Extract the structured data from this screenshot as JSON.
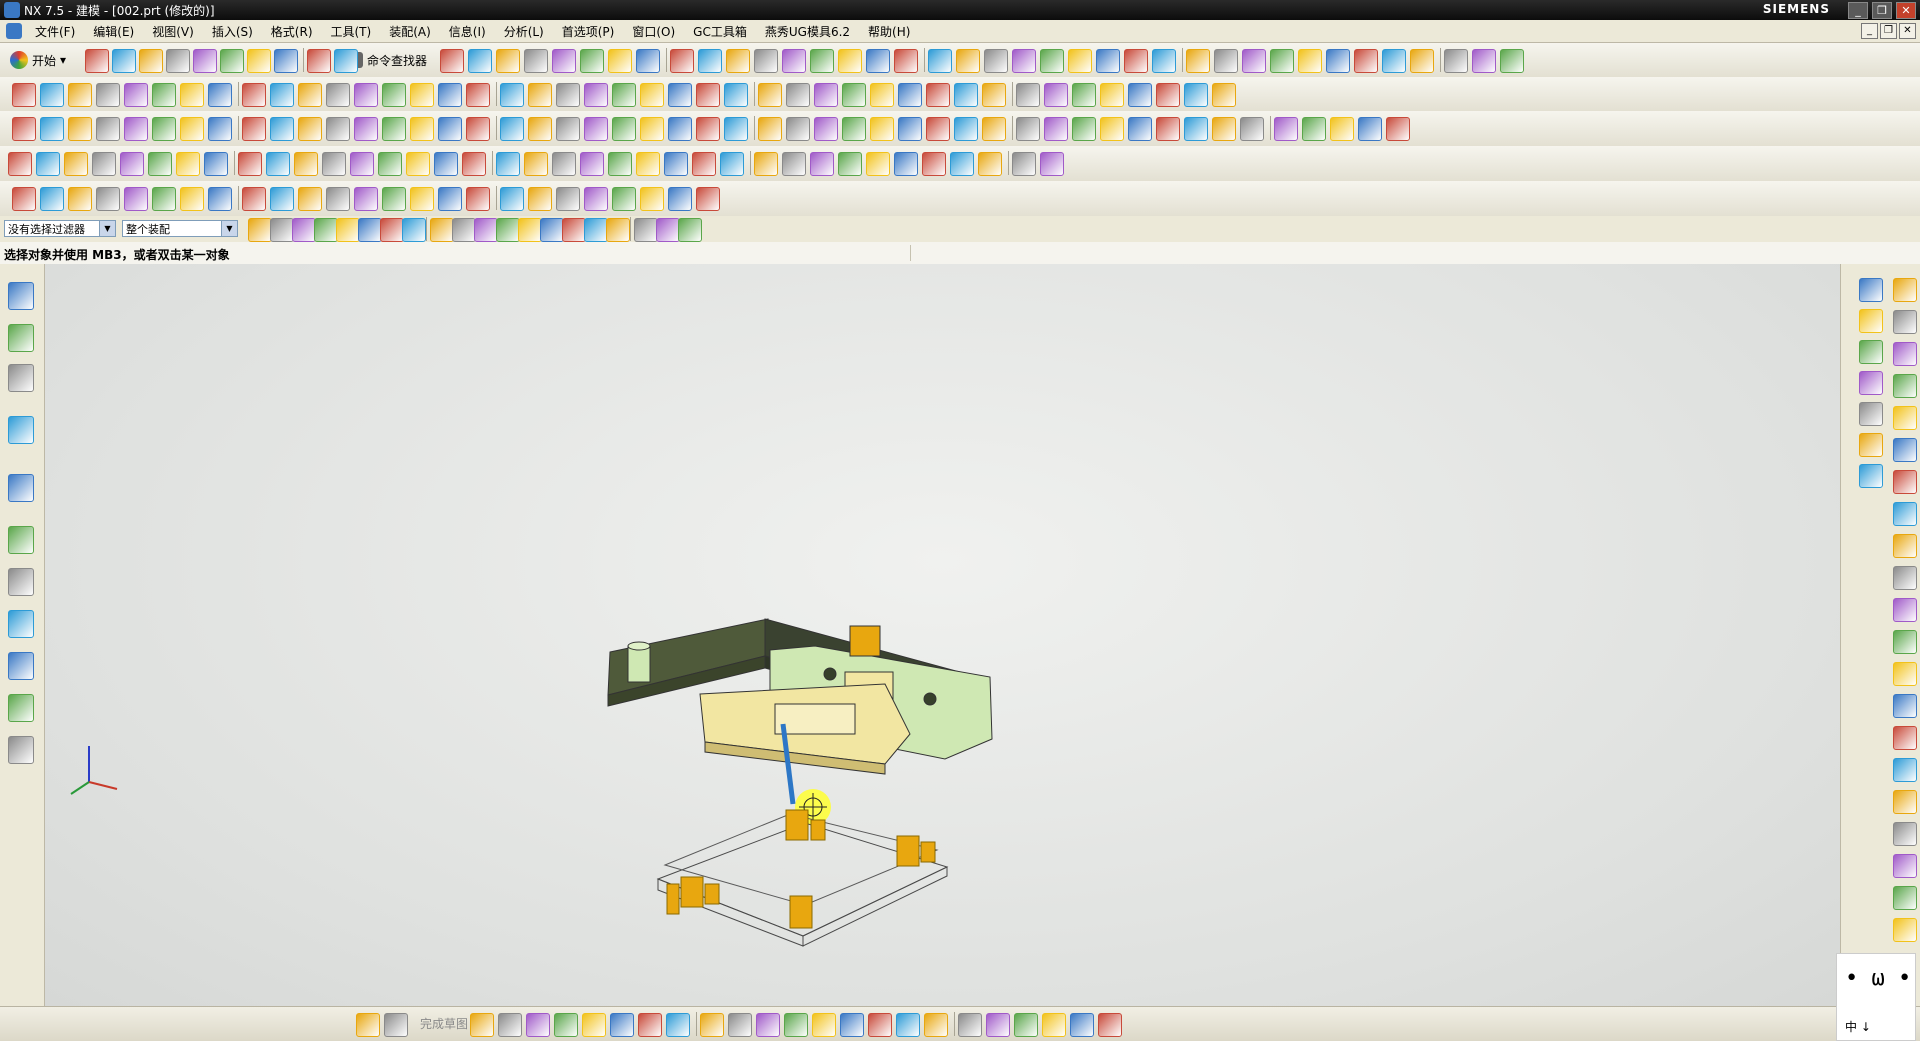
{
  "window": {
    "title": "NX 7.5 - 建模 - [002.prt (修改的)]",
    "brand": "SIEMENS"
  },
  "menu": [
    "文件(F)",
    "编辑(E)",
    "视图(V)",
    "插入(S)",
    "格式(R)",
    "工具(T)",
    "装配(A)",
    "信息(I)",
    "分析(L)",
    "首选项(P)",
    "窗口(O)",
    "GC工具箱",
    "燕秀UG模具6.2",
    "帮助(H)"
  ],
  "toolbar": {
    "start_label": "开始",
    "command_finder_label": "命令查找器"
  },
  "selection": {
    "filter_value": "没有选择过滤器",
    "scope_value": "整个装配"
  },
  "cue_line": "选择对象并使用 MB3，或者双击某一对象",
  "statusbar": {
    "finish_sketch": "完成草图"
  },
  "ime": {
    "face": "• ω •",
    "label": "中 ↓"
  },
  "colors": {
    "part_green": "#cfe8b3",
    "part_yellow": "#f2e6a2",
    "bolt_orange": "#e8a70f",
    "highlight": "#ffff30"
  }
}
